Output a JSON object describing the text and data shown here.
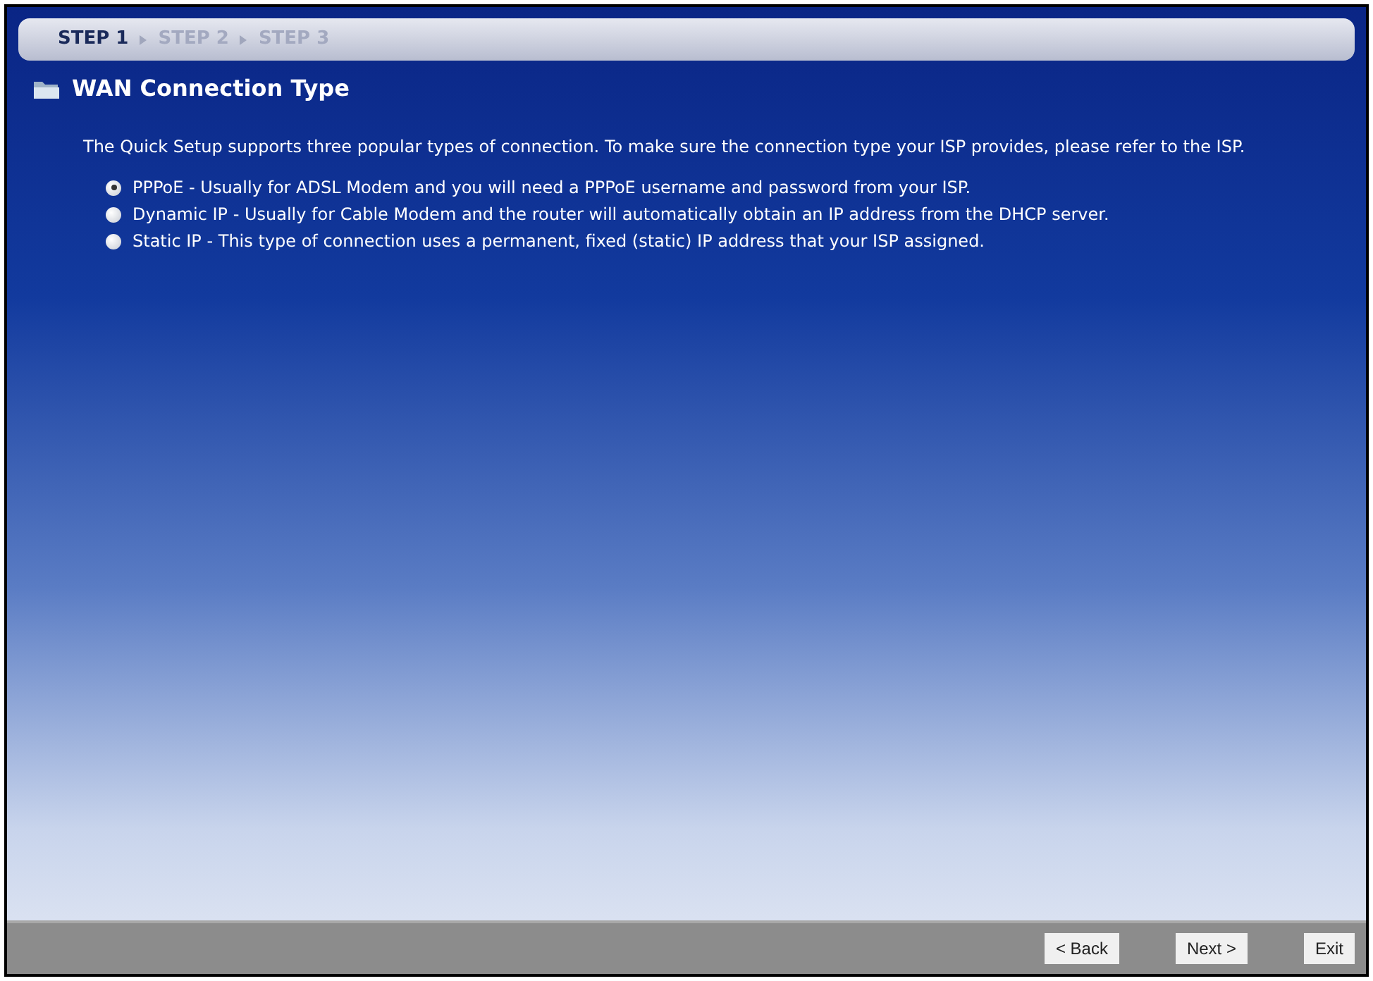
{
  "steps": [
    {
      "label": "STEP 1",
      "selected": true
    },
    {
      "label": "STEP 2",
      "selected": false
    },
    {
      "label": "STEP 3",
      "selected": false
    }
  ],
  "title": "WAN Connection Type",
  "intro": "The Quick Setup supports three popular types of connection. To make sure the connection type your ISP provides, please refer to the ISP.",
  "options": [
    {
      "label": "PPPoE - Usually for ADSL Modem and you will need a PPPoE username and password from your ISP.",
      "selected": true
    },
    {
      "label": "Dynamic IP - Usually for Cable Modem and the router will automatically obtain an IP address from the DHCP server.",
      "selected": false
    },
    {
      "label": "Static IP - This type of connection uses a permanent, fixed (static) IP address that your ISP assigned.",
      "selected": false
    }
  ],
  "buttons": [
    "< Back",
    "Next >",
    "Exit"
  ]
}
